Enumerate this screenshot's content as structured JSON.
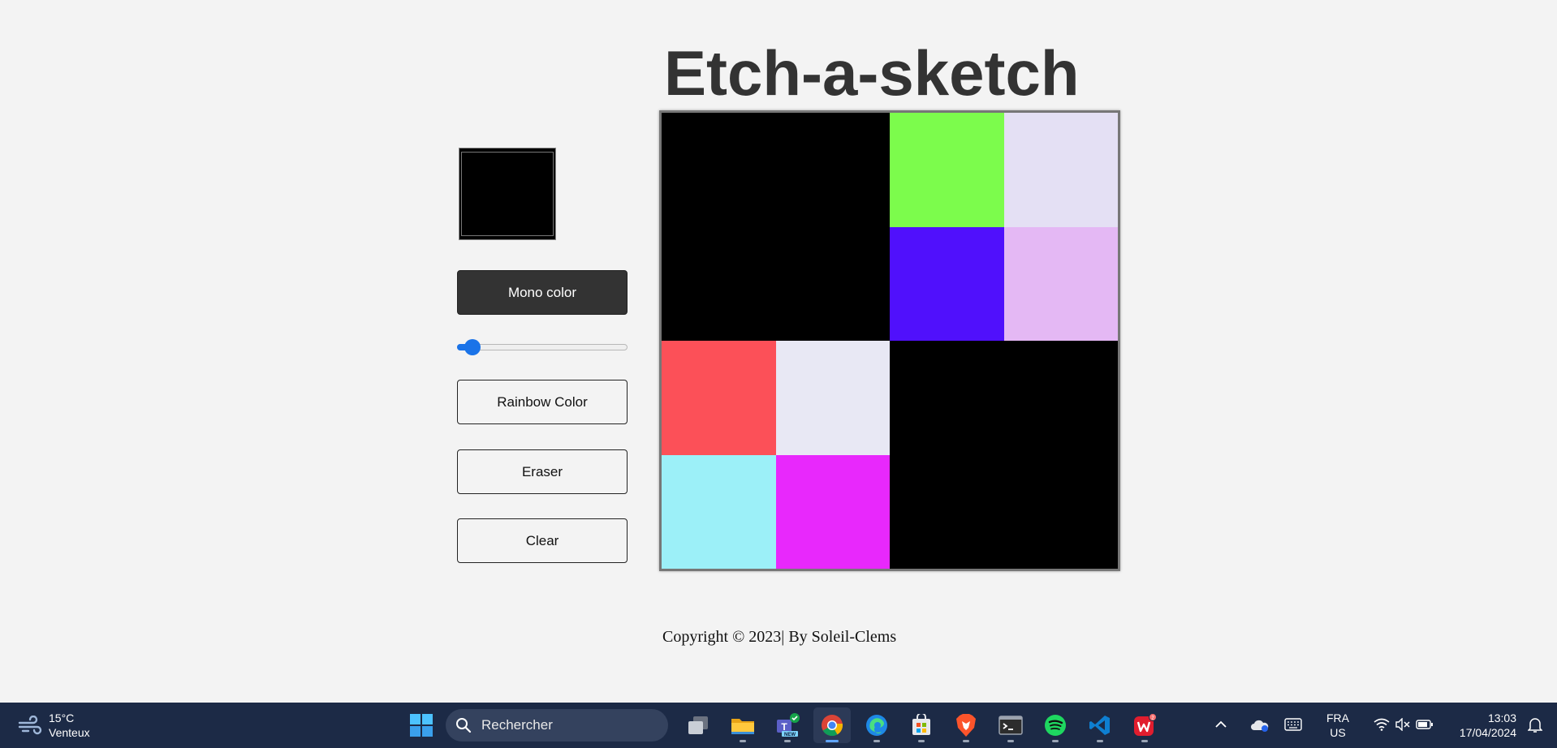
{
  "app": {
    "title": "Etch-a-sketch",
    "current_color": "#000000"
  },
  "controls": {
    "mono_label": "Mono color",
    "mono_active": true,
    "rainbow_label": "Rainbow Color",
    "eraser_label": "Eraser",
    "clear_label": "Clear",
    "grid_size_slider": {
      "value": 4,
      "min": 1,
      "max": 64
    }
  },
  "grid": {
    "size": 4,
    "cells": [
      [
        "#000000",
        "#000000",
        "#7cfc4c",
        "#e4e0f4"
      ],
      [
        "#000000",
        "#000000",
        "#5010fc",
        "#e4b8f4"
      ],
      [
        "#fc5058",
        "#e8e8f4",
        "#000000",
        "#000000"
      ],
      [
        "#9cf0f8",
        "#e828fc",
        "#000000",
        "#000000"
      ]
    ]
  },
  "footer": {
    "copyright": "Copyright © 2023| By Soleil-Clems"
  },
  "taskbar": {
    "weather": {
      "temp": "15°C",
      "condition": "Venteux",
      "icon": "wind-icon"
    },
    "search_label": "Rechercher",
    "apps": [
      {
        "name": "task-view-icon",
        "active": false,
        "open": false
      },
      {
        "name": "file-explorer-icon",
        "active": false,
        "open": true
      },
      {
        "name": "teams-icon",
        "active": false,
        "open": true
      },
      {
        "name": "chrome-icon",
        "active": true,
        "open": true
      },
      {
        "name": "edge-icon",
        "active": false,
        "open": true
      },
      {
        "name": "store-icon",
        "active": false,
        "open": true
      },
      {
        "name": "brave-icon",
        "active": false,
        "open": true
      },
      {
        "name": "terminal-icon",
        "active": false,
        "open": true
      },
      {
        "name": "spotify-icon",
        "active": false,
        "open": true
      },
      {
        "name": "vscode-icon",
        "active": false,
        "open": true
      },
      {
        "name": "wps-office-icon",
        "active": false,
        "open": true
      }
    ],
    "lang_primary": "FRA",
    "lang_secondary": "US",
    "time": "13:03",
    "date": "17/04/2024",
    "colors": {
      "taskbar_bg": "#1c2a46",
      "accent": "#1a73e8"
    }
  }
}
